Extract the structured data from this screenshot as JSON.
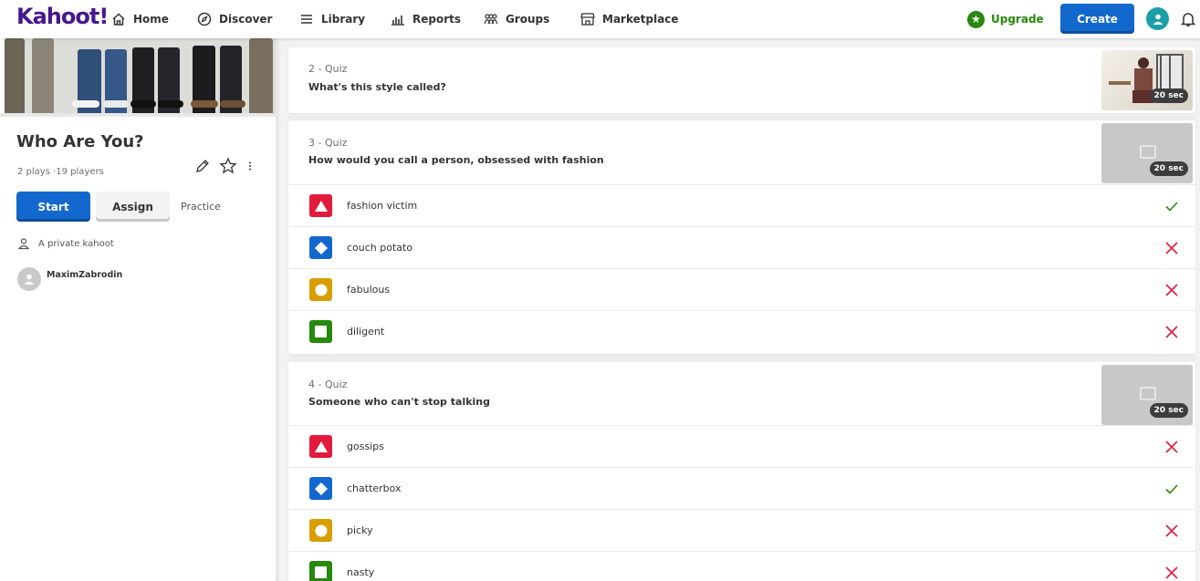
{
  "nav": {
    "logo": "Kahoot!",
    "items": [
      {
        "label": "Home",
        "icon": "home-icon"
      },
      {
        "label": "Discover",
        "icon": "compass-icon"
      },
      {
        "label": "Library",
        "icon": "list-icon"
      },
      {
        "label": "Reports",
        "icon": "bar-chart-icon"
      },
      {
        "label": "Groups",
        "icon": "people-icon"
      },
      {
        "label": "Marketplace",
        "icon": "store-icon"
      }
    ],
    "upgrade_label": "Upgrade",
    "create_label": "Create"
  },
  "kahoot": {
    "title": "Who Are You?",
    "plays": "2 plays ·19 players",
    "start_label": "Start",
    "assign_label": "Assign",
    "practice_label": "Practice",
    "visibility": "A private kahoot",
    "creator": "MaximZabrodin"
  },
  "questions": [
    {
      "number": "2 - Quiz",
      "text": "What's this style called?",
      "time": "20 sec",
      "has_image": true,
      "answers": []
    },
    {
      "number": "3 - Quiz",
      "text": "How would you call a person, obsessed with fashion",
      "time": "20 sec",
      "has_image": false,
      "answers": [
        {
          "text": "fashion victim",
          "correct": true,
          "shape": "triangle",
          "color": "#e21b3c"
        },
        {
          "text": "couch potato",
          "correct": false,
          "shape": "diamond",
          "color": "#1368ce"
        },
        {
          "text": "fabulous",
          "correct": false,
          "shape": "circle",
          "color": "#d89e00"
        },
        {
          "text": "diligent",
          "correct": false,
          "shape": "square",
          "color": "#26890c"
        }
      ]
    },
    {
      "number": "4 - Quiz",
      "text": "Someone who can't stop talking",
      "time": "20 sec",
      "has_image": false,
      "answers": [
        {
          "text": "gossips",
          "correct": false,
          "shape": "triangle",
          "color": "#e21b3c"
        },
        {
          "text": "chatterbox",
          "correct": true,
          "shape": "diamond",
          "color": "#1368ce"
        },
        {
          "text": "picky",
          "correct": false,
          "shape": "circle",
          "color": "#d89e00"
        },
        {
          "text": "nasty",
          "correct": false,
          "shape": "square",
          "color": "#26890c"
        }
      ]
    }
  ],
  "colors": {
    "brand": "#46178f",
    "primary": "#1368ce",
    "correct": "#26890c",
    "wrong": "#e21b3c"
  }
}
